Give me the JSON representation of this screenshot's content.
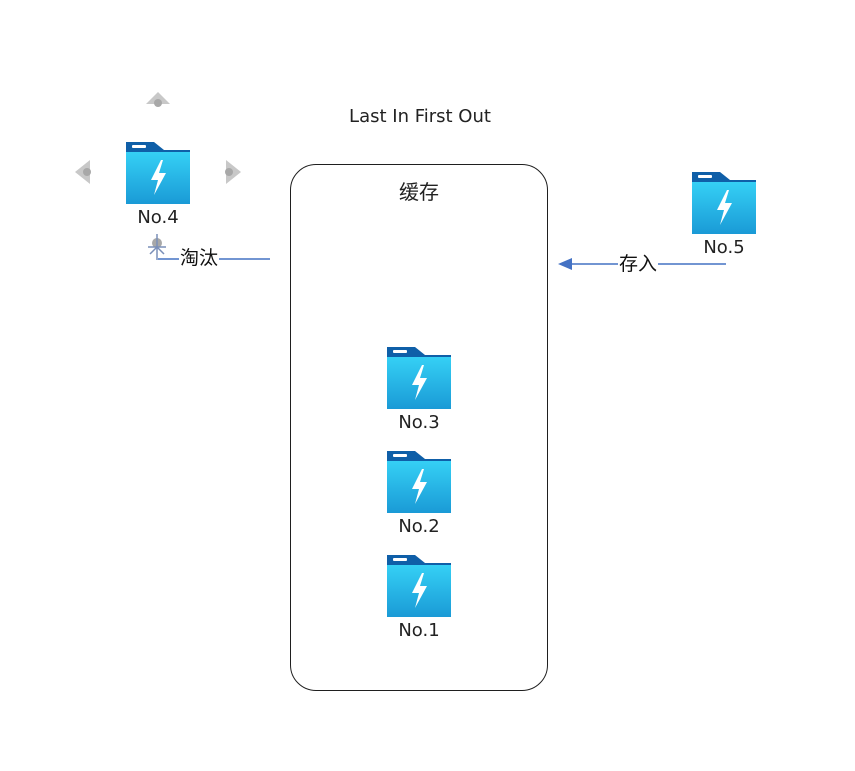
{
  "diagram": {
    "title": "Last In First Out",
    "container": {
      "label": "缓存"
    },
    "items_in_cache": [
      {
        "label": "No.3",
        "icon": "folder-lightning-icon"
      },
      {
        "label": "No.2",
        "icon": "folder-lightning-icon"
      },
      {
        "label": "No.1",
        "icon": "folder-lightning-icon"
      }
    ],
    "evicted_item": {
      "label": "No.4",
      "icon": "folder-lightning-icon"
    },
    "incoming_item": {
      "label": "No.5",
      "icon": "folder-lightning-icon"
    },
    "edges": {
      "evict_label": "淘汰",
      "store_label": "存入"
    },
    "colors": {
      "arrow": "#4472C4",
      "folder_dark": "#0F5FA8",
      "folder_light": "#2FC6F0",
      "handles": "#C8C8C8"
    }
  }
}
